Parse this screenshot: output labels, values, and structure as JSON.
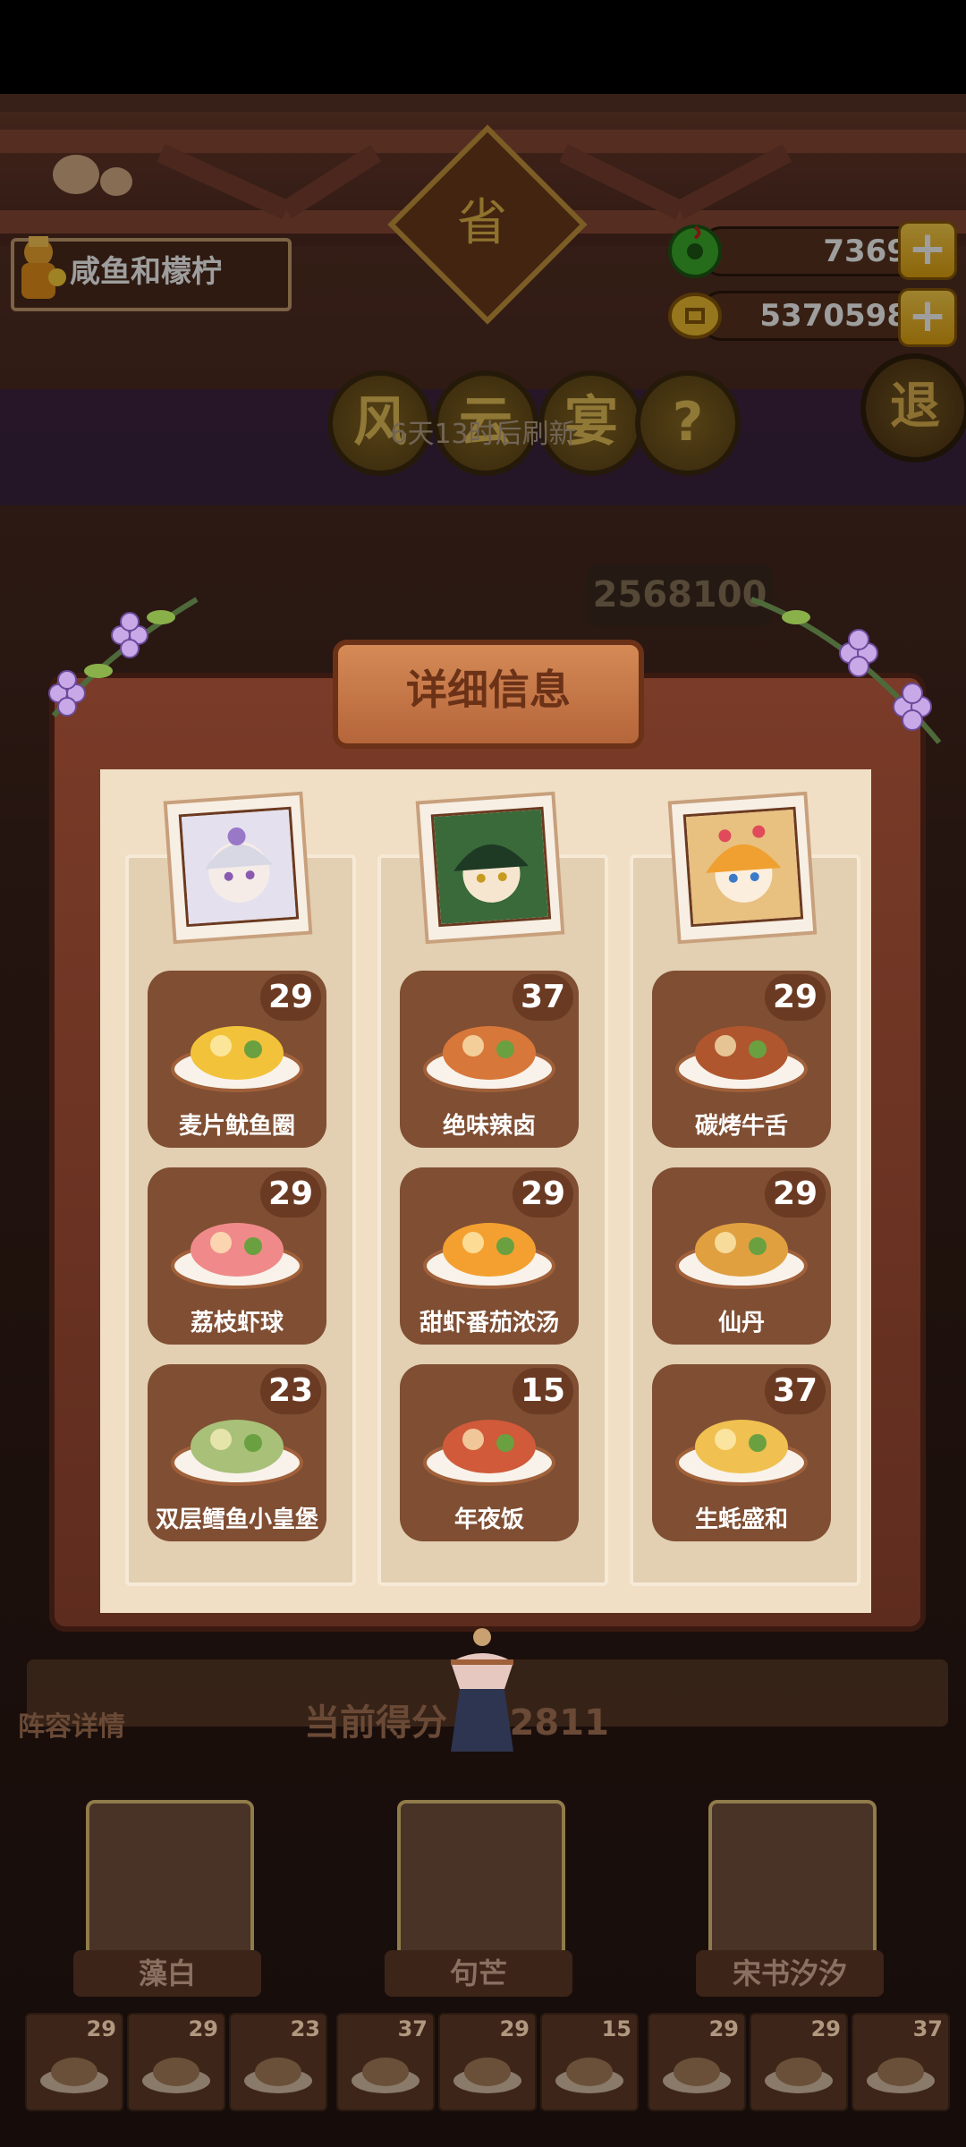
{
  "player": {
    "name": "咸鱼和檬柠"
  },
  "currency": {
    "jade": "7369",
    "gold": "5370598"
  },
  "header": {
    "plaque": "省",
    "buttons": [
      "风",
      "云",
      "宴",
      "?"
    ],
    "exit": "退"
  },
  "refresh_text": "6天13时后刷新",
  "background_score": "2568100",
  "modal": {
    "title": "详细信息",
    "columns": [
      {
        "dishes": [
          {
            "name": "麦片鱿鱼圈",
            "level": "29"
          },
          {
            "name": "荔枝虾球",
            "level": "29"
          },
          {
            "name": "双层鳕鱼小皇堡",
            "level": "23"
          }
        ]
      },
      {
        "dishes": [
          {
            "name": "绝味辣卤",
            "level": "37"
          },
          {
            "name": "甜虾番茄浓汤",
            "level": "29"
          },
          {
            "name": "年夜饭",
            "level": "15"
          }
        ]
      },
      {
        "dishes": [
          {
            "name": "碳烤牛舌",
            "level": "29"
          },
          {
            "name": "仙丹",
            "level": "29"
          },
          {
            "name": "生蚝盛和",
            "level": "37"
          }
        ]
      }
    ]
  },
  "bottom": {
    "lineup_label": "阵容详情",
    "current_score": "当前得分 332811",
    "heroes": [
      "藻白",
      "句芒",
      "宋书汐汐"
    ],
    "dish_levels": [
      "29",
      "29",
      "23",
      "37",
      "29",
      "15",
      "29",
      "29",
      "37"
    ]
  }
}
